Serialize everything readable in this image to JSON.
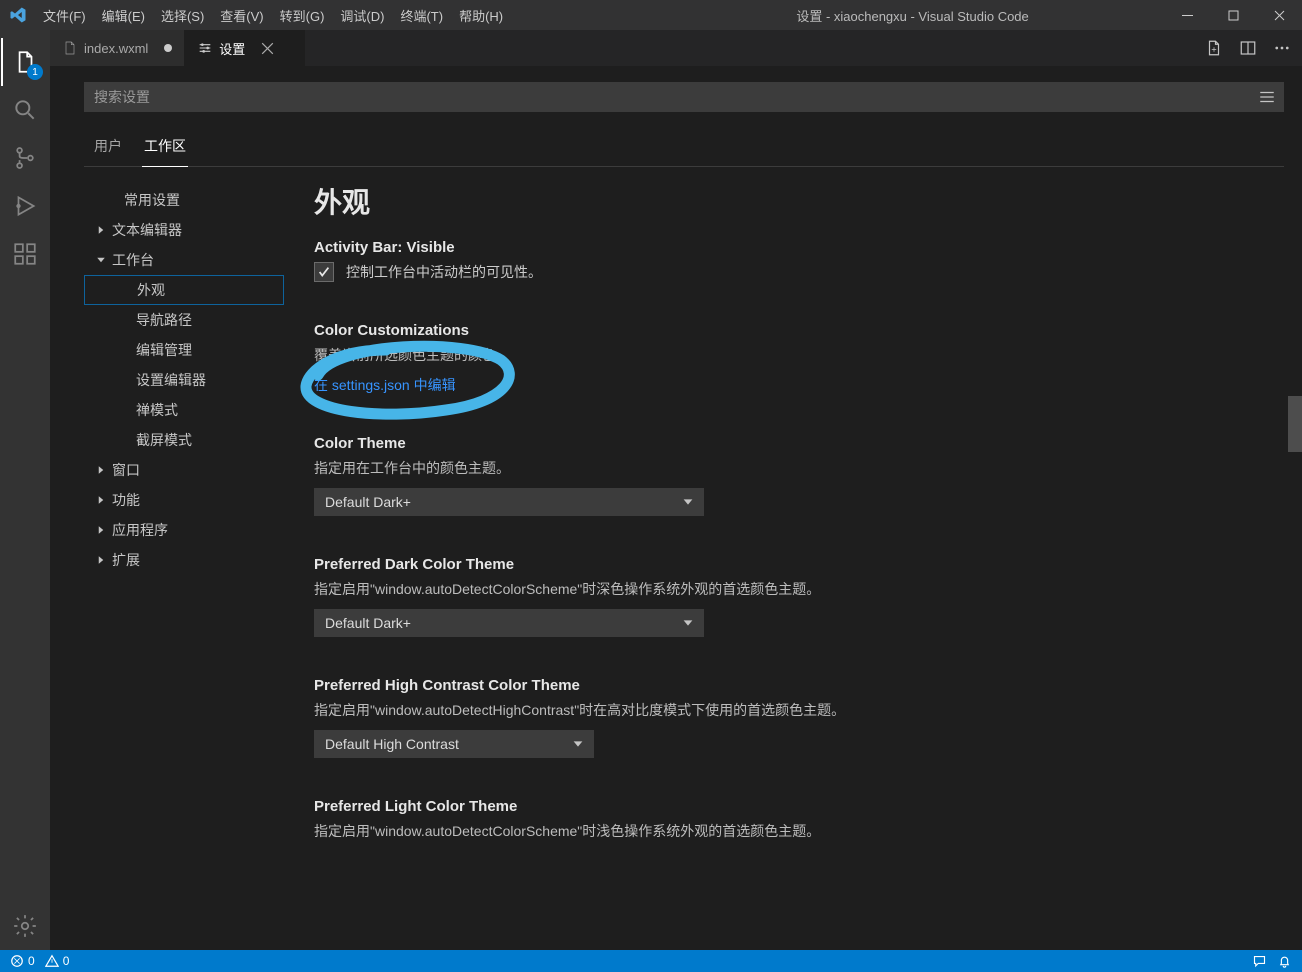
{
  "title_bar": {
    "menus": [
      "文件(F)",
      "编辑(E)",
      "选择(S)",
      "查看(V)",
      "转到(G)",
      "调试(D)",
      "终端(T)",
      "帮助(H)"
    ],
    "title": "设置 - xiaochengxu - Visual Studio Code"
  },
  "activity_bar": {
    "explorer_badge": "1"
  },
  "tabs": {
    "tab1_label": "index.wxml",
    "tab2_label": "设置"
  },
  "search": {
    "placeholder": "搜索设置"
  },
  "scope_tabs": {
    "user": "用户",
    "workspace": "工作区"
  },
  "toc": {
    "common": "常用设置",
    "text_editor": "文本编辑器",
    "workbench": "工作台",
    "appearance": "外观",
    "breadcrumbs": "导航路径",
    "editor_mgmt": "编辑管理",
    "settings_editor": "设置编辑器",
    "zen": "禅模式",
    "screencast": "截屏模式",
    "window": "窗口",
    "features": "功能",
    "application": "应用程序",
    "extensions": "扩展"
  },
  "content": {
    "section_title": "外观",
    "activity_bar": {
      "head_prefix": "Activity Bar: ",
      "head_sub": "Visible",
      "cb_label": "控制工作台中活动栏的可见性。"
    },
    "color_cust": {
      "head": "Color Customizations",
      "desc": "覆盖当前所选颜色主题的颜色。",
      "link": "在 settings.json 中编辑"
    },
    "color_theme": {
      "head": "Color Theme",
      "desc": "指定用在工作台中的颜色主题。",
      "value": "Default Dark+"
    },
    "pref_dark": {
      "head": "Preferred Dark Color Theme",
      "desc": "指定启用\"window.autoDetectColorScheme\"时深色操作系统外观的首选颜色主题。",
      "value": "Default Dark+"
    },
    "pref_hc": {
      "head": "Preferred High Contrast Color Theme",
      "desc": "指定启用\"window.autoDetectHighContrast\"时在高对比度模式下使用的首选颜色主题。",
      "value": "Default High Contrast"
    },
    "pref_light": {
      "head": "Preferred Light Color Theme",
      "desc": "指定启用\"window.autoDetectColorScheme\"时浅色操作系统外观的首选颜色主题。"
    }
  },
  "status_bar": {
    "errors": "0",
    "warnings": "0"
  }
}
